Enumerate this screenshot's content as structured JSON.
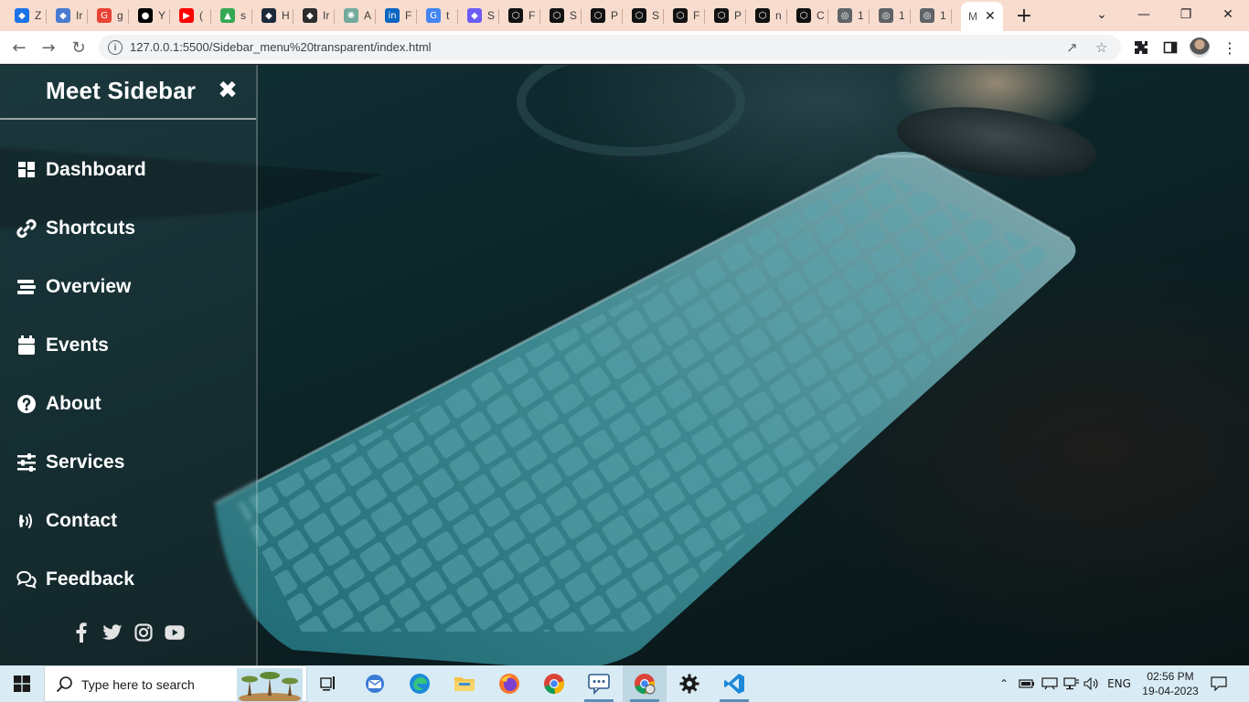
{
  "browser": {
    "tabs": [
      {
        "title": "Z",
        "icon": "site-icon",
        "color": "#1a73e8"
      },
      {
        "title": "Ir",
        "icon": "site-icon",
        "color": "#4a7bd0"
      },
      {
        "title": "g",
        "icon": "google-icon",
        "color": "#ea4335"
      },
      {
        "title": "Y",
        "icon": "github-icon",
        "color": "#000000"
      },
      {
        "title": "(",
        "icon": "youtube-icon",
        "color": "#ff0000"
      },
      {
        "title": "s",
        "icon": "drive-icon",
        "color": "#34a853"
      },
      {
        "title": "H",
        "icon": "site-icon",
        "color": "#1b2a3a"
      },
      {
        "title": "Ir",
        "icon": "site-icon",
        "color": "#2d2d2d"
      },
      {
        "title": "A",
        "icon": "chatgpt-icon",
        "color": "#74aa9c"
      },
      {
        "title": "F",
        "icon": "linkedin-icon",
        "color": "#0a66c2"
      },
      {
        "title": "t",
        "icon": "google-icon",
        "color": "#4285f4"
      },
      {
        "title": "S",
        "icon": "site-icon",
        "color": "#6b5cf6"
      },
      {
        "title": "F",
        "icon": "codepen-icon",
        "color": "#111111"
      },
      {
        "title": "S",
        "icon": "codepen-icon",
        "color": "#111111"
      },
      {
        "title": "P",
        "icon": "codepen-icon",
        "color": "#111111"
      },
      {
        "title": "S",
        "icon": "codepen-icon",
        "color": "#111111"
      },
      {
        "title": "F",
        "icon": "codepen-icon",
        "color": "#111111"
      },
      {
        "title": "P",
        "icon": "codepen-icon",
        "color": "#111111"
      },
      {
        "title": "n",
        "icon": "codepen-icon",
        "color": "#111111"
      },
      {
        "title": "C",
        "icon": "codepen-icon",
        "color": "#111111"
      },
      {
        "title": "1",
        "icon": "globe-icon",
        "color": "#5f6368"
      },
      {
        "title": "1",
        "icon": "globe-icon",
        "color": "#5f6368"
      },
      {
        "title": "1",
        "icon": "globe-icon",
        "color": "#5f6368"
      }
    ],
    "active_tab_title": "M",
    "url": "127.0.0.1:5500/Sidebar_menu%20transparent/index.html"
  },
  "sidebar": {
    "title": "Meet Sidebar",
    "items": [
      {
        "label": "Dashboard",
        "icon": "dashboard-icon"
      },
      {
        "label": "Shortcuts",
        "icon": "link-icon"
      },
      {
        "label": "Overview",
        "icon": "stream-icon"
      },
      {
        "label": "Events",
        "icon": "calendar-icon"
      },
      {
        "label": "About",
        "icon": "question-circle-icon"
      },
      {
        "label": "Services",
        "icon": "sliders-icon"
      },
      {
        "label": "Contact",
        "icon": "phone-volume-icon"
      },
      {
        "label": "Feedback",
        "icon": "comments-icon"
      }
    ],
    "socials": [
      "facebook-icon",
      "twitter-icon",
      "instagram-icon",
      "youtube-icon"
    ]
  },
  "taskbar": {
    "search_placeholder": "Type here to search",
    "language": "ENG",
    "time": "02:56 PM",
    "date": "19-04-2023"
  }
}
